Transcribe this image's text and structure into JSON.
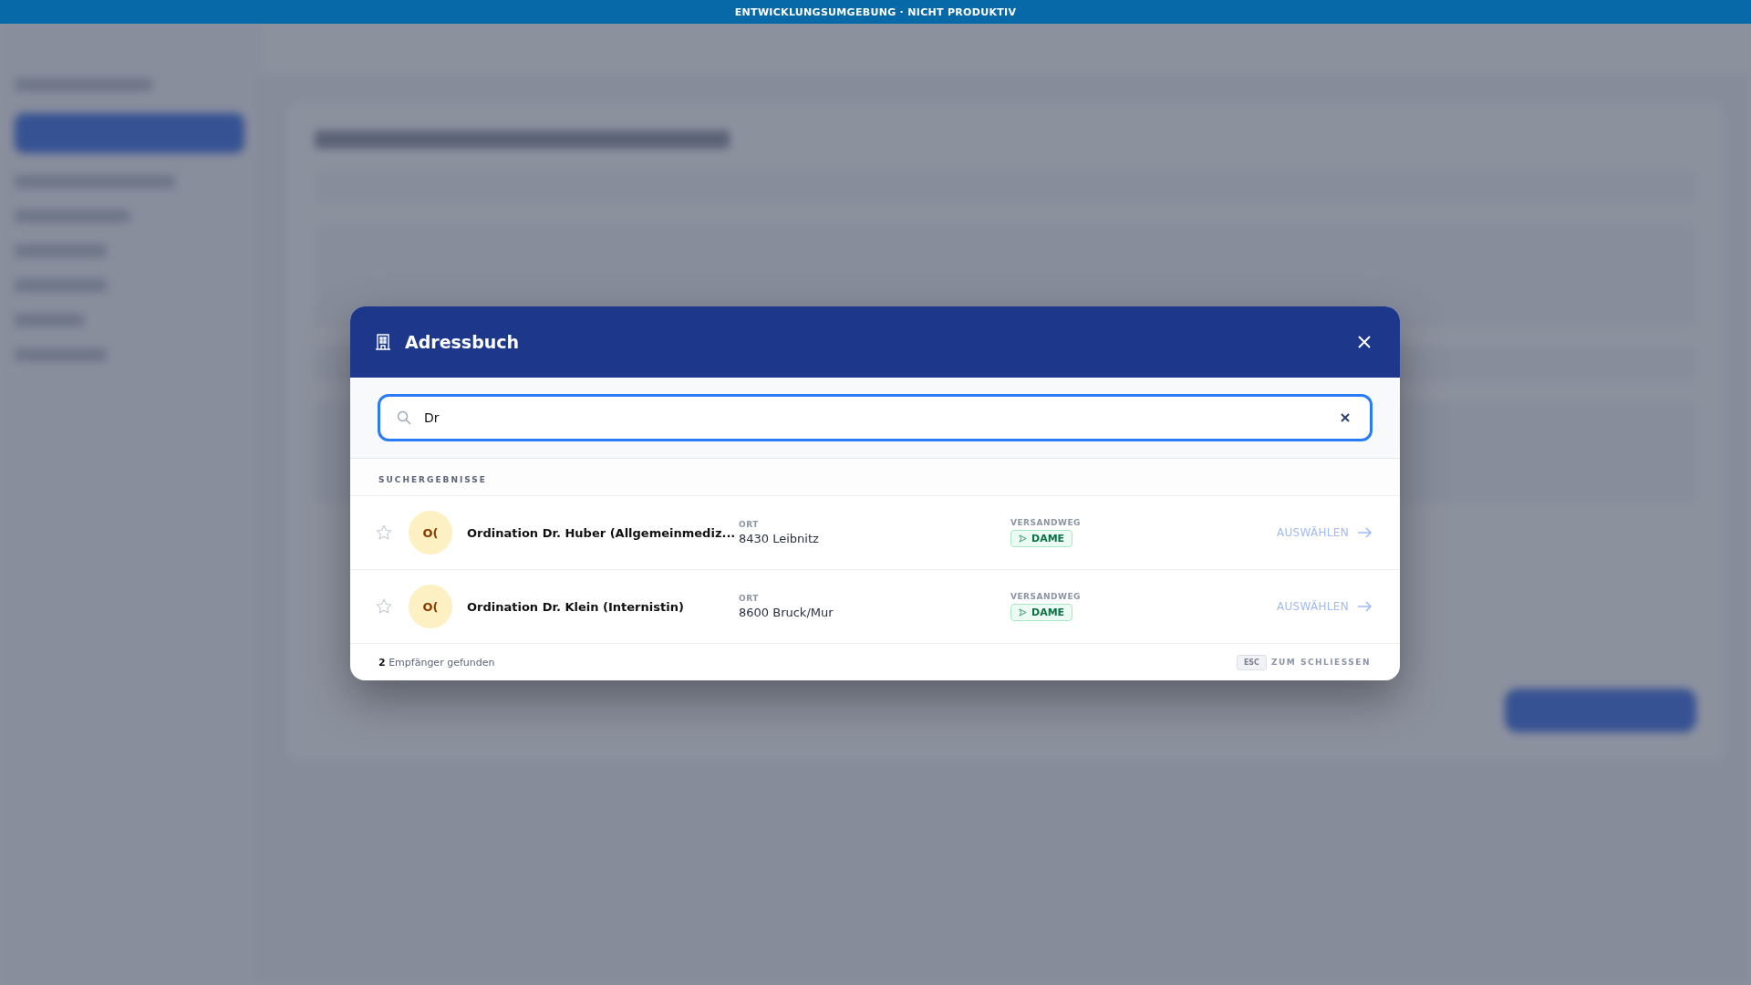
{
  "banner": "ENTWICKLUNGSUMGEBUNG · NICHT PRODUKTIV",
  "dialog": {
    "title": "Adressbuch",
    "search": {
      "value": "Dr"
    },
    "section_label": "SUCHERGEBNISSE",
    "results": [
      {
        "favorite": false,
        "initials": "O(",
        "name": "Ordination Dr. Huber (Allgemeinmediz...",
        "place_label": "ORT",
        "place": "8430 Leibnitz",
        "shipping_label": "VERSANDWEG",
        "shipping": "DAME",
        "action": "AUSWÄHLEN"
      },
      {
        "favorite": false,
        "initials": "O(",
        "name": "Ordination Dr. Klein (Internistin)",
        "place_label": "ORT",
        "place": "8600 Bruck/Mur",
        "shipping_label": "VERSANDWEG",
        "shipping": "DAME",
        "action": "AUSWÄHLEN"
      }
    ],
    "footer": {
      "count": "**2** Empfänger gefunden",
      "key": "ESC",
      "key_hint": "ZUM SCHLIESSEN"
    }
  }
}
